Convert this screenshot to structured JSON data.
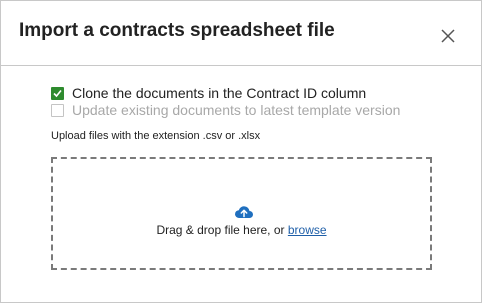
{
  "dialog": {
    "title": "Import a contracts spreadsheet file"
  },
  "icons": {
    "close": "close-icon",
    "checkmark": "checkmark-icon",
    "upload": "cloud-upload-icon"
  },
  "options": [
    {
      "label": "Clone the documents in the Contract ID column",
      "checked": true,
      "disabled": false
    },
    {
      "label": "Update existing documents to latest template version",
      "checked": false,
      "disabled": true
    }
  ],
  "upload": {
    "hint": "Upload files with the extension .csv or .xlsx",
    "drop_text": "Drag & drop file here, or ",
    "browse_label": "browse"
  },
  "colors": {
    "checkbox_checked": "#2e8b2e",
    "link": "#1f5fa8",
    "upload_icon": "#1f6fbf",
    "disabled_text": "#a8a8a8"
  }
}
